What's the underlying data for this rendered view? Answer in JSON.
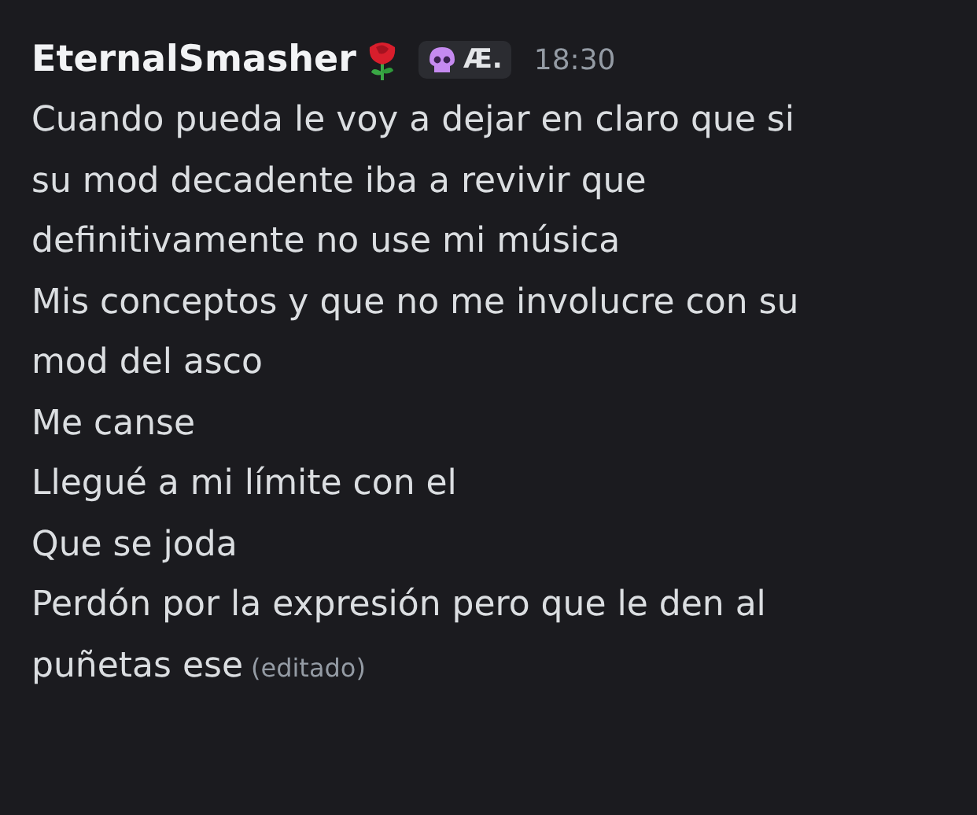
{
  "author": {
    "name": "EternalSmasher",
    "tag": "Æ."
  },
  "time": "18:30",
  "messages": [
    {
      "lines": [
        "Cuando pueda le voy a dejar en claro que si",
        "su mod decadente iba a revivir que",
        "definitivamente no use mi música"
      ]
    },
    {
      "lines": [
        "Mis conceptos y que no me involucre con su",
        "mod del asco"
      ]
    },
    {
      "lines": [
        "Me canse"
      ]
    },
    {
      "lines": [
        "Llegué a mi límite con el"
      ]
    },
    {
      "lines": [
        "Que se joda"
      ]
    },
    {
      "lines": [
        "Perdón por la expresión pero que le den al",
        "puñetas ese"
      ],
      "edited": "(editado)"
    }
  ]
}
